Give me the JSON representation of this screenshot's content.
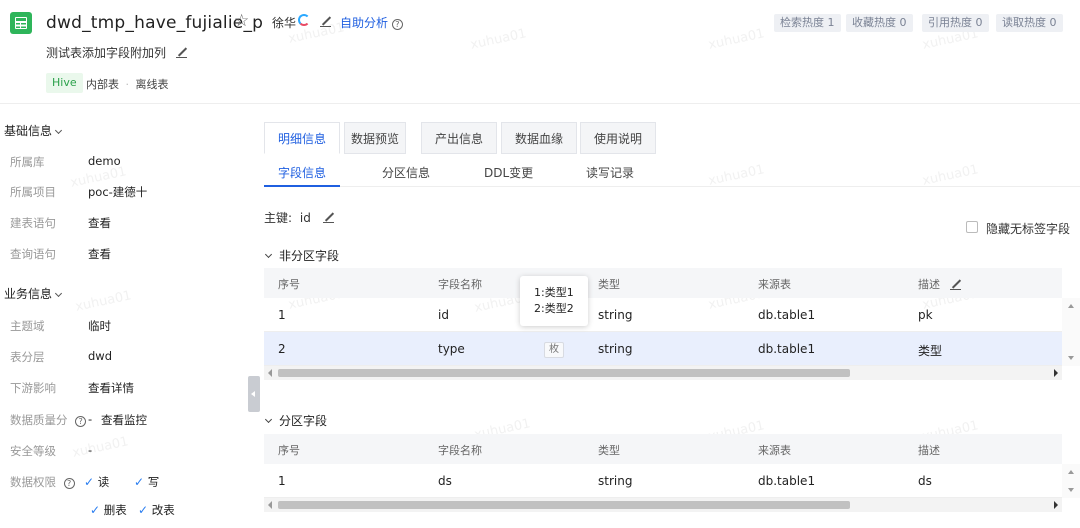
{
  "header": {
    "table_name": "dwd_tmp_have_fujialie_p",
    "owner": "徐华",
    "auto_analysis": "自助分析",
    "description": "测试表添加字段附加列",
    "storage_tag": "Hive",
    "table_type_1": "内部表",
    "table_type_2": "离线表",
    "stats": {
      "search": "检索热度 1",
      "favorite": "收藏热度 0",
      "reference": "引用热度 0",
      "read": "读取热度 0"
    }
  },
  "left": {
    "basic_title": "基础信息",
    "basic": [
      {
        "label": "所属库",
        "value": "demo"
      },
      {
        "label": "所属项目",
        "value": "poc-建德十"
      },
      {
        "label": "建表语句",
        "value": "查看"
      },
      {
        "label": "查询语句",
        "value": "查看"
      }
    ],
    "business_title": "业务信息",
    "business": [
      {
        "label": "主题域",
        "value": "临时"
      },
      {
        "label": "表分层",
        "value": "dwd"
      },
      {
        "label": "下游影响",
        "value": "查看详情"
      }
    ],
    "quality_label": "数据质量分",
    "quality_value": "-",
    "quality_link": "查看监控",
    "security_label": "安全等级",
    "security_value": "-",
    "perm_label": "数据权限",
    "perms": [
      "读",
      "写",
      "删表",
      "改表"
    ]
  },
  "tabs": [
    "明细信息",
    "数据预览",
    "产出信息",
    "数据血缘",
    "使用说明"
  ],
  "subtabs": [
    "字段信息",
    "分区信息",
    "DDL变更",
    "读写记录"
  ],
  "primary_key_label": "主键:",
  "primary_key_value": "id",
  "hide_untagged": "隐藏无标签字段",
  "non_partition_title": "非分区字段",
  "partition_title": "分区字段",
  "columns": [
    "序号",
    "字段名称",
    "类型",
    "来源表",
    "描述"
  ],
  "non_partition_rows": [
    {
      "no": "1",
      "name": "id",
      "type": "string",
      "source": "db.table1",
      "desc": "pk"
    },
    {
      "no": "2",
      "name": "type",
      "type": "string",
      "source": "db.table1",
      "desc": "类型"
    }
  ],
  "partition_rows": [
    {
      "no": "1",
      "name": "ds",
      "type": "string",
      "source": "db.table1",
      "desc": "ds"
    }
  ],
  "tooltip": [
    "1:类型1",
    "2:类型2"
  ],
  "enum_badge": "枚",
  "watermark": "xuhua01"
}
